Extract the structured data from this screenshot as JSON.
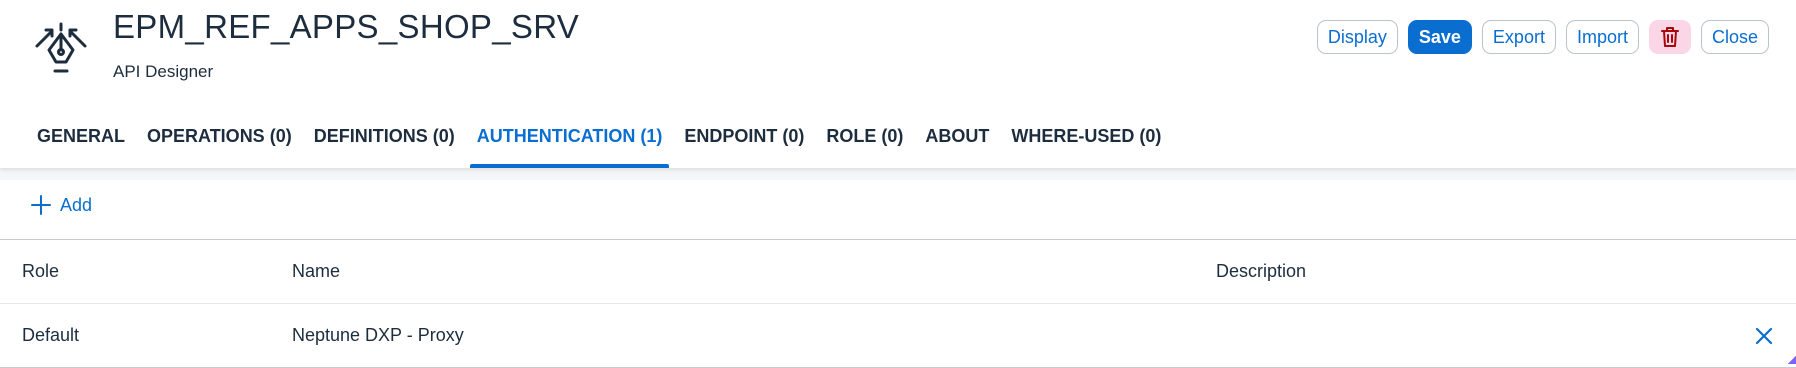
{
  "header": {
    "title": "EPM_REF_APPS_SHOP_SRV",
    "subtitle": "API Designer",
    "icon": "api-designer-icon"
  },
  "actions": {
    "display": "Display",
    "save": "Save",
    "export": "Export",
    "import": "Import",
    "delete_icon": "trash-icon",
    "close": "Close"
  },
  "tabs": [
    {
      "label": "GENERAL",
      "active": false
    },
    {
      "label": "OPERATIONS (0)",
      "active": false
    },
    {
      "label": "DEFINITIONS (0)",
      "active": false
    },
    {
      "label": "AUTHENTICATION (1)",
      "active": true
    },
    {
      "label": "ENDPOINT (0)",
      "active": false
    },
    {
      "label": "ROLE (0)",
      "active": false
    },
    {
      "label": "ABOUT",
      "active": false
    },
    {
      "label": "WHERE-USED (0)",
      "active": false
    }
  ],
  "toolbar": {
    "add_label": "Add",
    "add_icon": "plus-icon"
  },
  "table": {
    "columns": [
      "Role",
      "Name",
      "Description"
    ],
    "rows": [
      {
        "role": "Default",
        "name": "Neptune DXP - Proxy",
        "description": ""
      }
    ]
  },
  "colors": {
    "accent": "#0a6ed1",
    "text": "#1d2d3e",
    "danger_bg": "#fbd6e6",
    "danger_icon": "#aa0808"
  }
}
